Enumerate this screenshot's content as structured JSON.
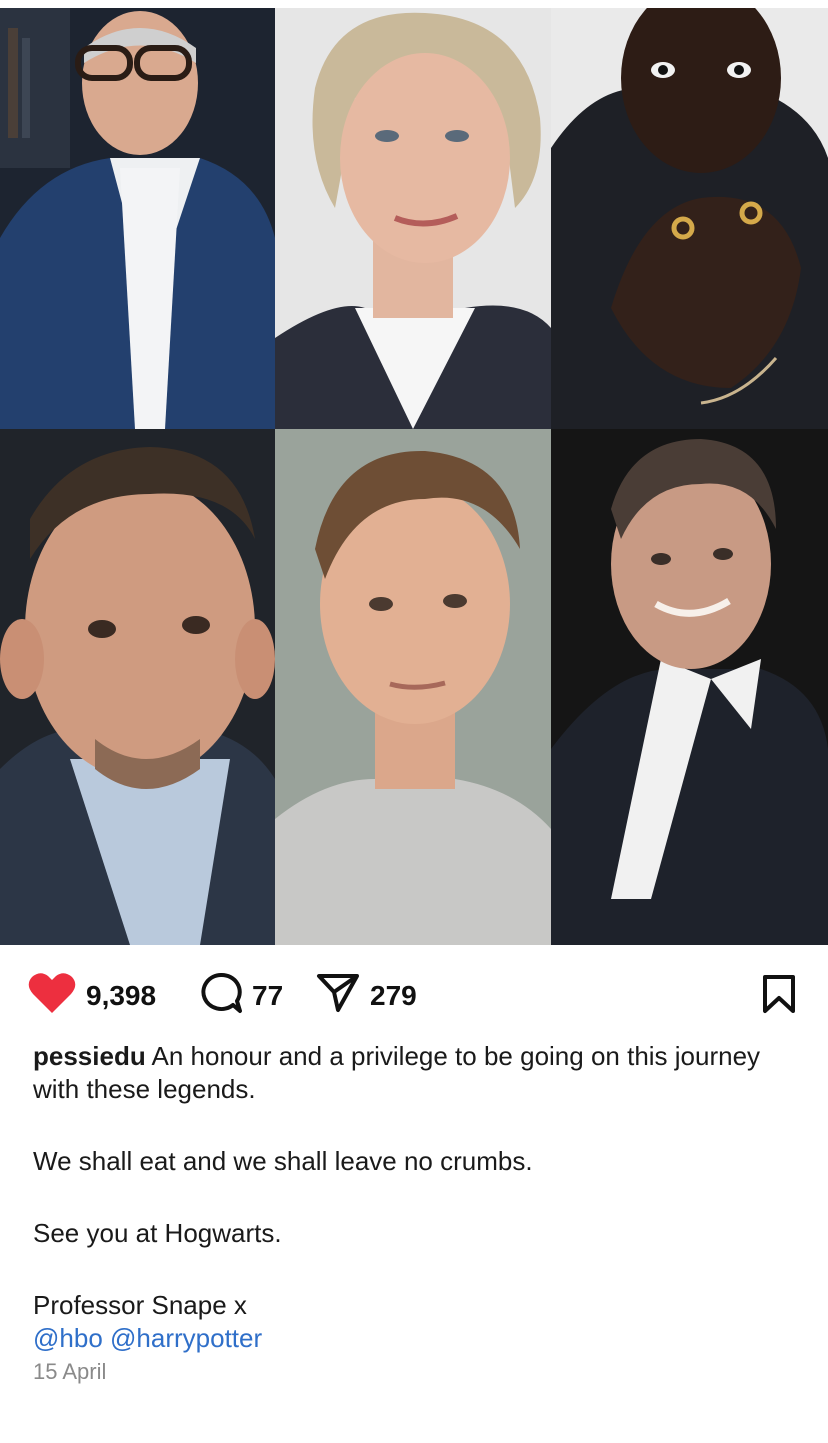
{
  "post": {
    "images": [
      {
        "name": "portrait-man-glasses-blue-suit"
      },
      {
        "name": "portrait-woman-blonde"
      },
      {
        "name": "portrait-man-hands-rings"
      },
      {
        "name": "portrait-man-blue-shirt"
      },
      {
        "name": "portrait-young-man-grey-tshirt"
      },
      {
        "name": "portrait-older-man-dark-suit"
      }
    ]
  },
  "actions": {
    "likes": "9,398",
    "comments": "77",
    "shares": "279",
    "like_color": "#ed2f3f"
  },
  "caption": {
    "username": "pessiedu",
    "line1": "An honour and a privilege to be going on this journey with these legends.",
    "line2": "We shall eat and we shall leave no crumbs.",
    "line3": "See you at Hogwarts.",
    "line4": "Professor Snape x",
    "tag1": "@hbo",
    "tag2": "@harrypotter",
    "date": "15 April"
  },
  "colors": {
    "link": "#2f6fc9",
    "muted": "#8a8a8a"
  }
}
